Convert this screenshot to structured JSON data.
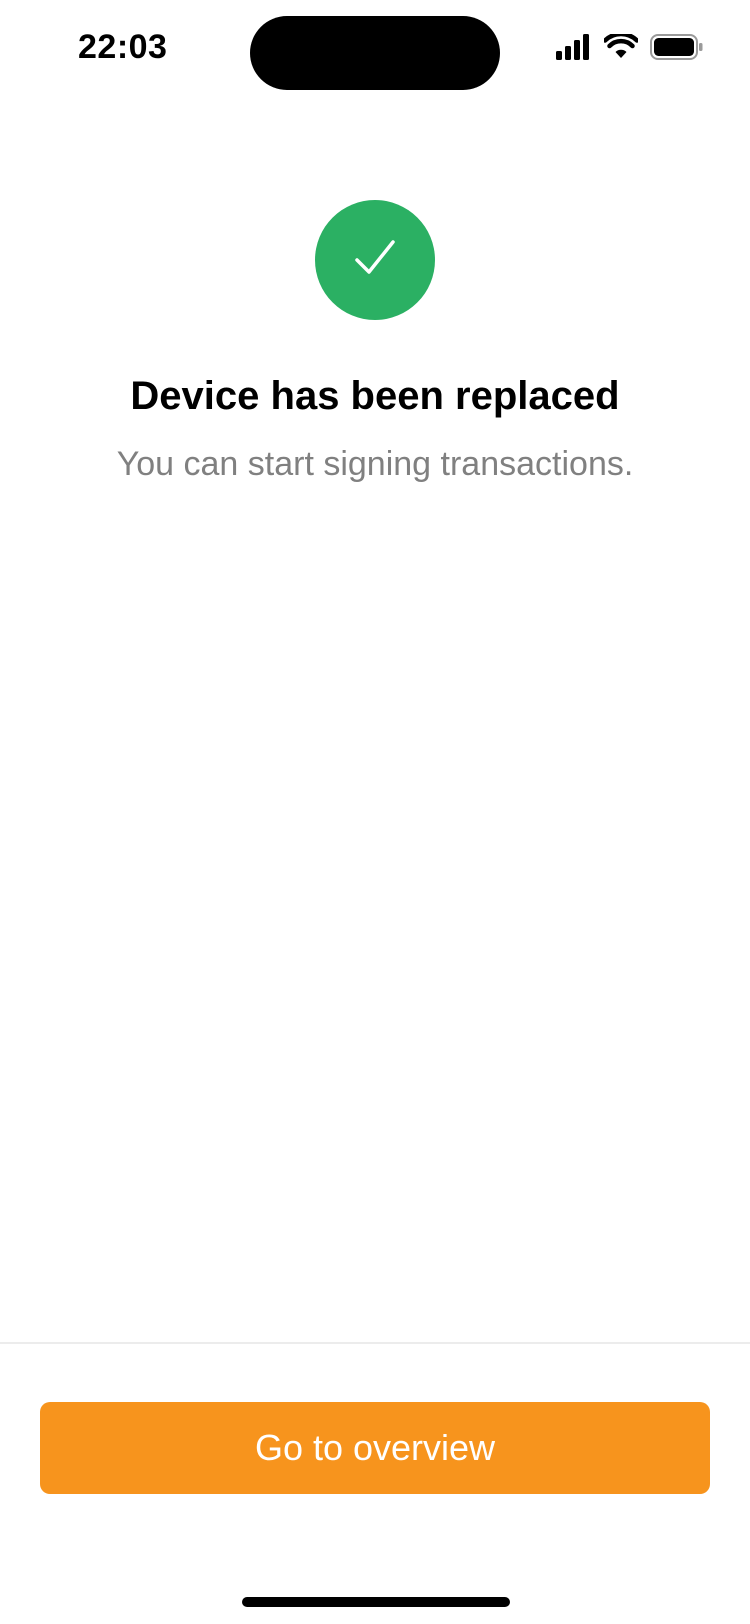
{
  "status_bar": {
    "time": "22:03",
    "icons": [
      "cellular-signal-icon",
      "wifi-icon",
      "battery-icon"
    ]
  },
  "hero": {
    "icon": "checkmark-icon",
    "icon_color": "#2bb063",
    "title": "Device has been replaced",
    "subtitle": "You can start signing transactions."
  },
  "footer": {
    "cta_label": "Go to overview",
    "cta_color": "#f7941d"
  }
}
